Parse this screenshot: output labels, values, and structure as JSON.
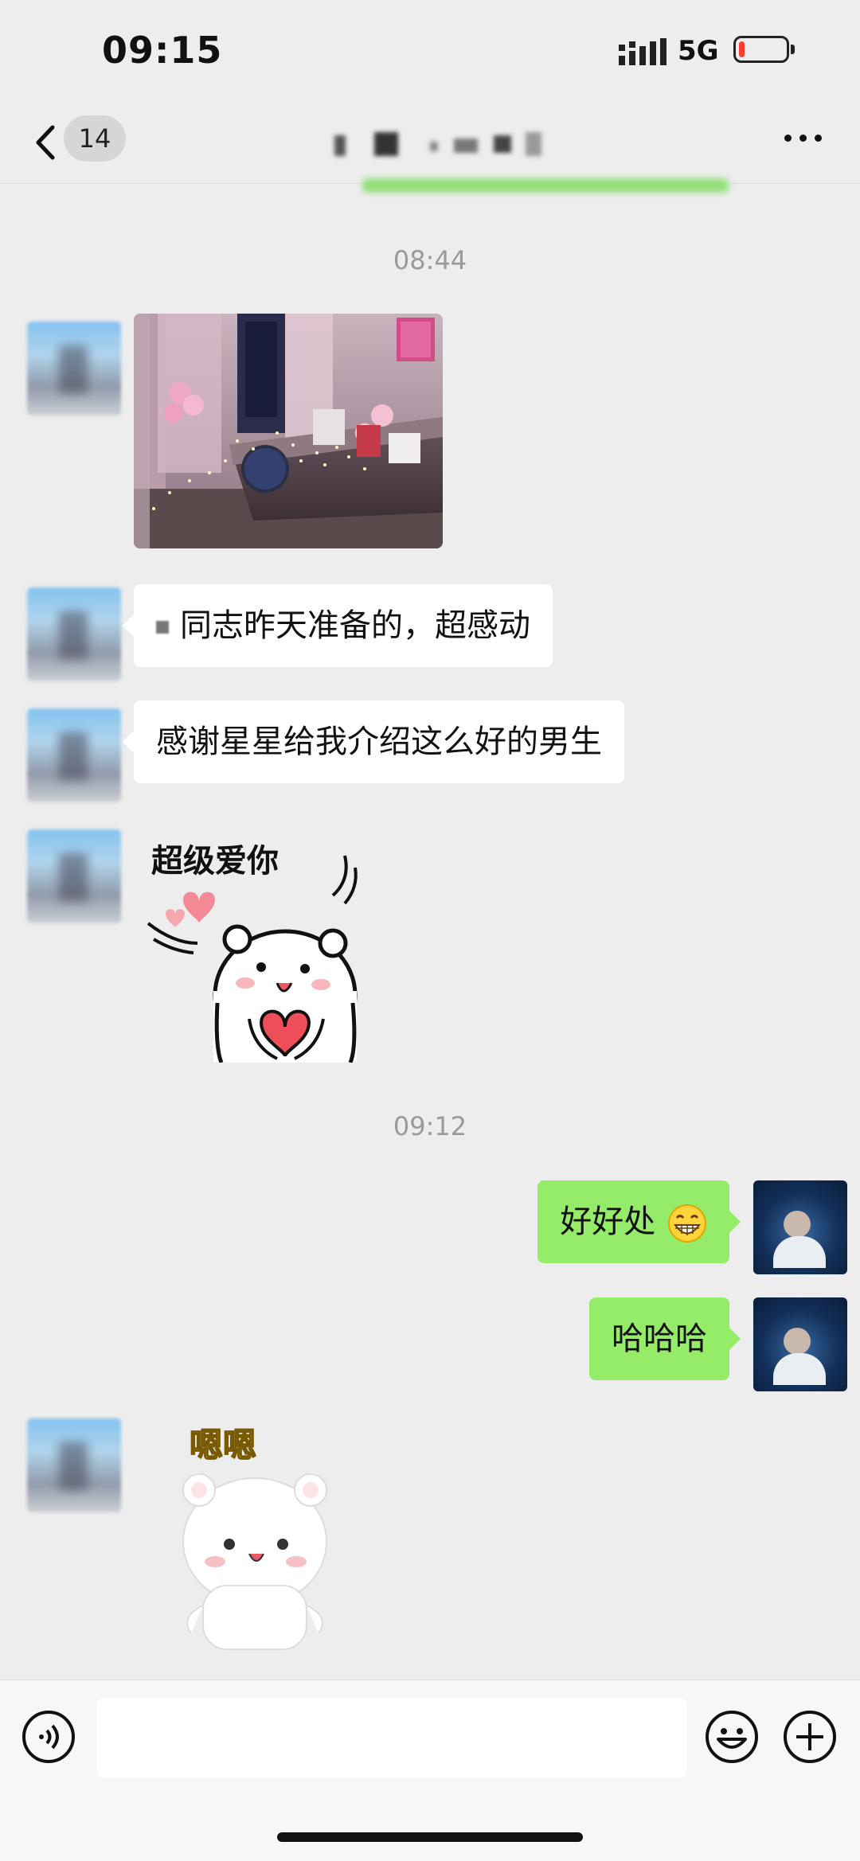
{
  "status_bar": {
    "time": "09:15",
    "network": "5G",
    "battery_level": 0.12
  },
  "nav": {
    "unread_count": "14",
    "more_icon": "more-dots-icon",
    "back_icon": "chevron-left-icon"
  },
  "messages": {
    "time_1": "08:44",
    "text_1": "同志昨天准备的，超感动",
    "text_2": "感谢星星给我介绍这么好的男生",
    "sticker_1_caption": "超级爱你",
    "time_2": "09:12",
    "reply_1": "好好处",
    "reply_2": "哈哈哈",
    "sticker_2_caption": "嗯嗯"
  },
  "input_bar": {
    "icons": [
      "voice-icon",
      "emoji-icon",
      "plus-icon"
    ]
  },
  "colors": {
    "background": "#ededed",
    "outgoing_bubble": "#95ec69",
    "incoming_bubble": "#ffffff",
    "timestamp": "#9a9a9a"
  }
}
